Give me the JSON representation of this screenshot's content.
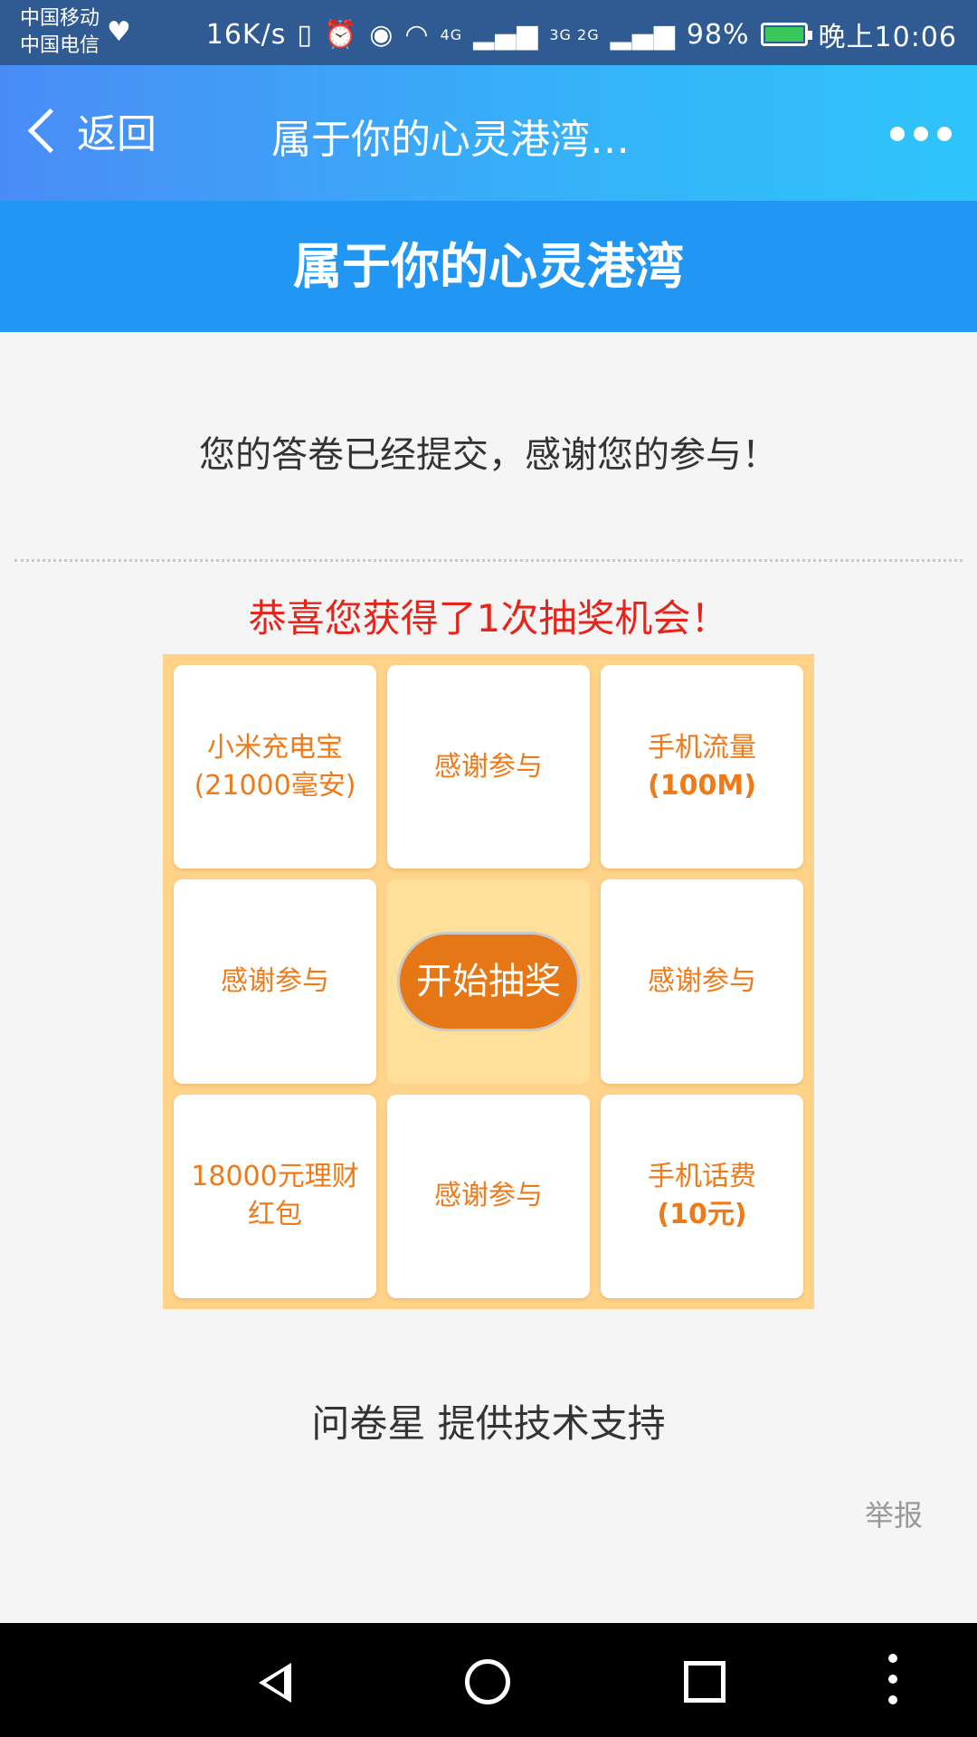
{
  "status_bar": {
    "carrier1": "中国移动",
    "carrier2": "中国电信",
    "speed": "16K/s",
    "net1": "4G",
    "net2": "3G 2G",
    "battery": "98%",
    "time": "晚上10:06"
  },
  "nav": {
    "back_label": "返回",
    "title": "属于你的心灵港湾…"
  },
  "banner": {
    "title": "属于你的心灵港湾"
  },
  "message": "您的答卷已经提交，感谢您的参与！",
  "congrats": "恭喜您获得了1次抽奖机会！",
  "prizes": {
    "p1_line1": "小米充电宝",
    "p1_line2": "(21000毫安)",
    "p2": "感谢参与",
    "p3_line1": "手机流量",
    "p3_line2": "(100M)",
    "p4": "感谢参与",
    "start": "开始抽奖",
    "p6": "感谢参与",
    "p7_line1": "18000元理财",
    "p7_line2": "红包",
    "p8": "感谢参与",
    "p9_line1": "手机话费",
    "p9_line2": "(10元)"
  },
  "footer": {
    "support": "问卷星 提供技术支持",
    "report": "举报"
  },
  "colors": {
    "banner": "#2196f3",
    "congrats": "#e5241a",
    "prize_text": "#f07a18",
    "start_button": "#e67716",
    "grid_bg": "#ffd48a"
  }
}
